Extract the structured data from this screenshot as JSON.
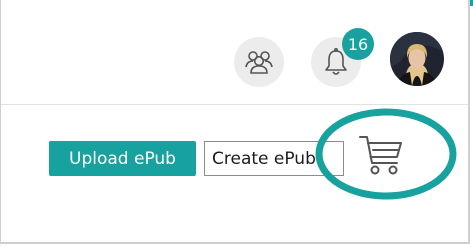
{
  "theme": {
    "accent": "#17a2a0",
    "icon_stroke": "#555555",
    "icon_bg": "#ececec"
  },
  "header": {
    "group_icon": "group-icon",
    "notifications": {
      "icon": "bell-icon",
      "count": "16"
    },
    "avatar": "user-avatar"
  },
  "toolbar": {
    "upload_label": "Upload ePub",
    "create_label": "Create ePub",
    "cart_icon": "shopping-cart-icon"
  },
  "annotation": {
    "shape": "ellipse",
    "color": "#17a2a0",
    "target": "shopping-cart-icon"
  }
}
